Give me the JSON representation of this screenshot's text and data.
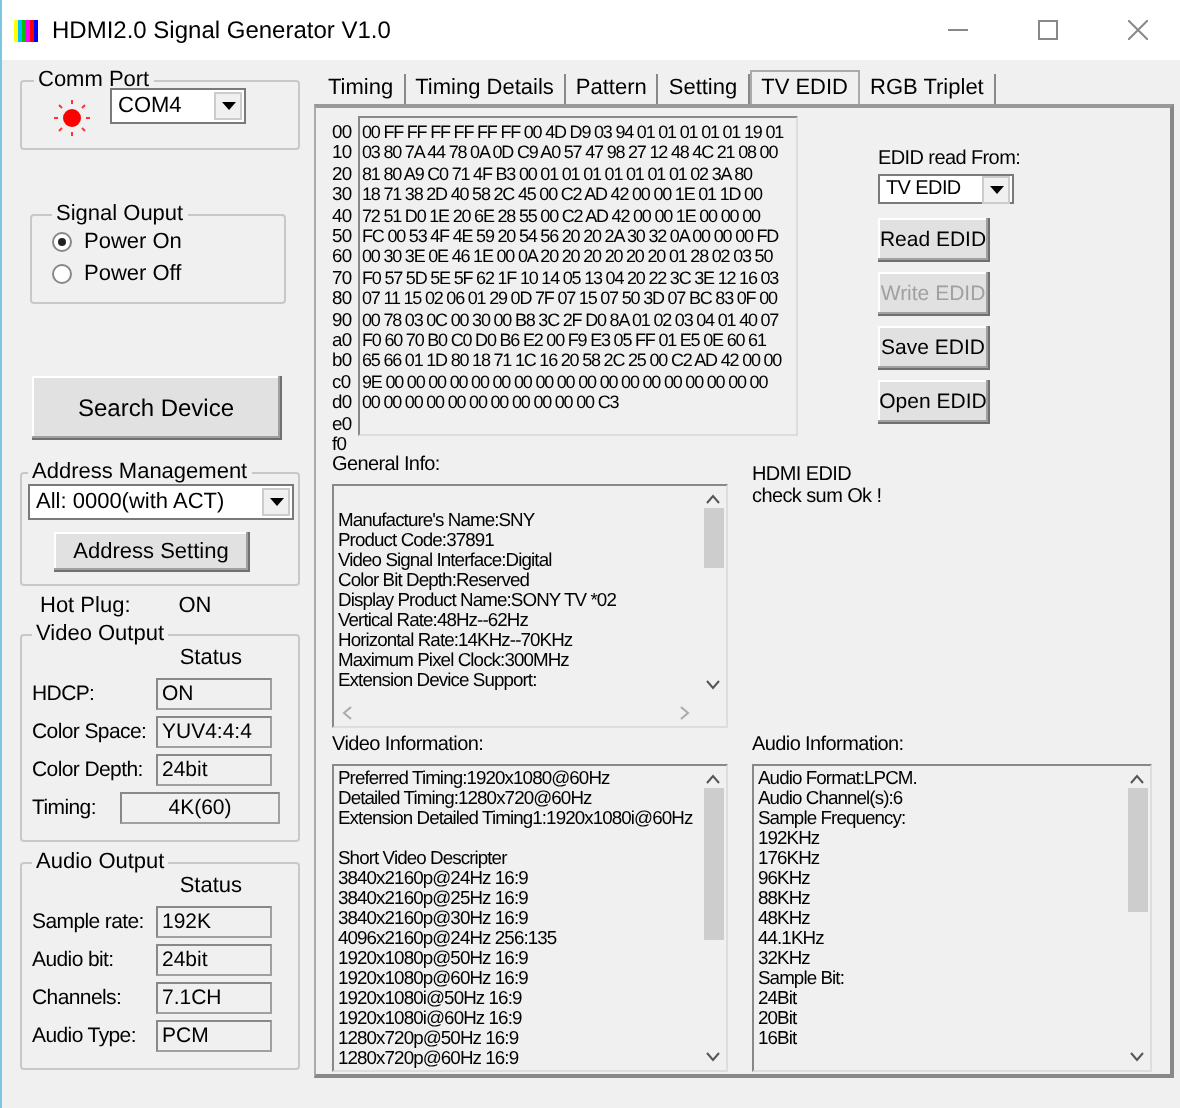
{
  "window": {
    "title": "HDMI2.0 Signal Generator V1.0"
  },
  "comm_port": {
    "label": "Comm Port",
    "port": "COM4"
  },
  "signal_output": {
    "label": "Signal Ouput",
    "options": [
      {
        "label": "Power On",
        "selected": true
      },
      {
        "label": "Power Off",
        "selected": false
      }
    ]
  },
  "search_button": "Search Device",
  "address_management": {
    "label": "Address Management",
    "value": "All: 0000(with ACT)",
    "button": "Address Setting"
  },
  "hot_plug": {
    "label": "Hot Plug:",
    "value": "ON"
  },
  "video_output": {
    "label": "Video Output",
    "status_heading": "Status",
    "fields": [
      {
        "label": "HDCP:",
        "value": "ON",
        "kind": "short"
      },
      {
        "label": "Color Space:",
        "value": "YUV4:4:4",
        "kind": "short"
      },
      {
        "label": "Color Depth:",
        "value": "24bit",
        "kind": "short"
      },
      {
        "label": "Timing:",
        "value": "4K(60)",
        "kind": "wide"
      }
    ]
  },
  "audio_output": {
    "label": "Audio Output",
    "status_heading": "Status",
    "fields": [
      {
        "label": "Sample rate:",
        "value": "192K",
        "kind": "short"
      },
      {
        "label": "Audio bit:",
        "value": "24bit",
        "kind": "short"
      },
      {
        "label": "Channels:",
        "value": "7.1CH",
        "kind": "short"
      },
      {
        "label": "Audio Type:",
        "value": "PCM",
        "kind": "short"
      }
    ]
  },
  "tabs": [
    {
      "label": "Timing",
      "selected": false
    },
    {
      "label": "Timing Details",
      "selected": false
    },
    {
      "label": "Pattern",
      "selected": false
    },
    {
      "label": "Setting",
      "selected": false
    },
    {
      "label": "TV EDID",
      "selected": true
    },
    {
      "label": "RGB Triplet",
      "selected": false
    }
  ],
  "edid": {
    "offsets": [
      "00",
      "10",
      "20",
      "30",
      "40",
      "50",
      "60",
      "70",
      "80",
      "90",
      "a0",
      "b0",
      "c0",
      "d0",
      "e0",
      "f0"
    ],
    "hex_lines": [
      "00 FF FF FF FF FF FF 00 4D D9 03 94 01 01 01 01 01 19 01",
      "03 80 7A 44 78 0A 0D C9 A0 57 47 98 27 12 48 4C 21 08 00",
      "81 80 A9 C0 71 4F B3 00 01 01 01 01 01 01 01 02 3A 80",
      "18 71 38 2D 40 58 2C 45 00 C2 AD 42 00 00 1E 01 1D 00",
      "72 51 D0 1E 20 6E 28 55 00 C2 AD 42 00 00 1E 00 00 00",
      "FC 00 53 4F 4E 59 20 54 56 20 20 2A 30 32 0A 00 00 00 FD",
      "00 30 3E 0E 46 1E 00 0A 20 20 20 20 20 20 01 28 02 03 50",
      "F0 57 5D 5E 5F 62 1F 10 14 05 13 04 20 22 3C 3E 12 16 03",
      "07 11 15 02 06 01 29 0D 7F 07 15 07 50 3D 07 BC 83 0F 00",
      "00 78 03 0C 00 30 00 B8 3C 2F D0 8A 01 02 03 04 01 40 07",
      "F0 60 70 B0 C0 D0 B6 E2 00 F9 E3 05 FF 01 E5 0E 60 61",
      "65 66 01 1D 80 18 71 1C 16 20 58 2C 25 00 C2 AD 42 00 00",
      "9E 00 00 00 00 00 00 00 00 00 00 00 00 00 00 00 00 00 00",
      "00 00 00 00 00 00 00 00 00 00 00 C3"
    ],
    "read_from_label": "EDID read From:",
    "read_from": "TV EDID",
    "buttons": [
      {
        "label": "Read EDID",
        "disabled": false
      },
      {
        "label": "Write EDID",
        "disabled": true
      },
      {
        "label": "Save EDID",
        "disabled": false
      },
      {
        "label": "Open EDID",
        "disabled": false
      }
    ]
  },
  "general_info": {
    "label": "General Info:",
    "lines": [
      "Manufacture's Name:SNY",
      "Product Code:37891",
      "Video Signal Interface:Digital",
      "Color Bit Depth:Reserved",
      "Display Product Name:SONY TV  *02",
      "Vertical Rate:48Hz--62Hz",
      "Horizontal Rate:14KHz--70KHz",
      "Maximum Pixel Clock:300MHz",
      "Extension Device Support:"
    ]
  },
  "check_message": [
    "HDMI EDID",
    "check sum Ok !"
  ],
  "video_information": {
    "label": "Video Information:",
    "groups": [
      [
        "Preferred Timing:1920x1080@60Hz",
        "Detailed Timing:1280x720@60Hz",
        "Extension Detailed Timing1:1920x1080i@60Hz"
      ],
      [
        "Short Video Descripter",
        "3840x2160p@24Hz  16:9",
        "3840x2160p@25Hz  16:9",
        "3840x2160p@30Hz  16:9",
        "4096x2160p@24Hz  256:135",
        "1920x1080p@50Hz  16:9",
        "1920x1080p@60Hz  16:9",
        "1920x1080i@50Hz  16:9",
        "1920x1080i@60Hz  16:9",
        "1280x720p@50Hz  16:9",
        "1280x720p@60Hz  16:9"
      ]
    ]
  },
  "audio_information": {
    "label": "Audio Information:",
    "groups": [
      [
        "Audio Format:LPCM.",
        "Audio Channel(s):6",
        "Sample Frequency:",
        "192KHz",
        "176KHz",
        "96KHz",
        "88KHz",
        "48KHz",
        "44.1KHz",
        "32KHz",
        "Sample Bit:",
        "24Bit",
        "20Bit",
        "16Bit"
      ]
    ]
  }
}
